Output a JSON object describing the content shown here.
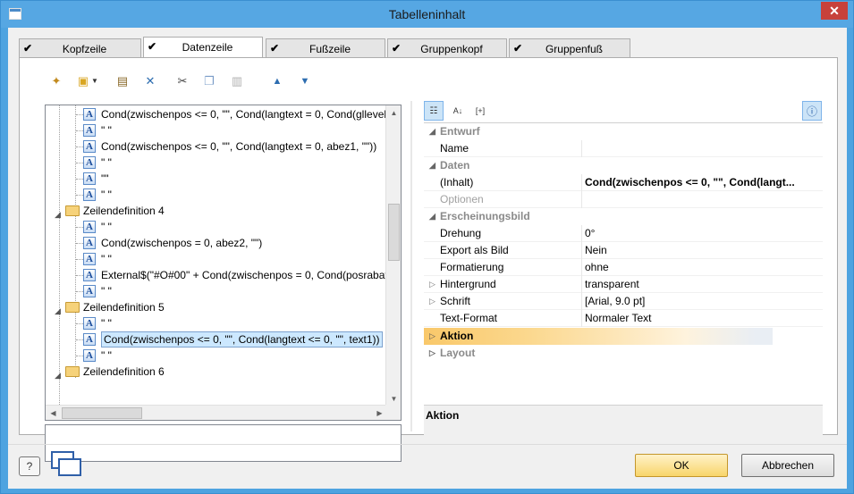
{
  "window": {
    "title": "Tabelleninhalt",
    "close_glyph": "✕"
  },
  "tabs": [
    {
      "label": "Kopfzeile",
      "checked": true
    },
    {
      "label": "Datenzeile",
      "checked": true,
      "active": true
    },
    {
      "label": "Fußzeile",
      "checked": true
    },
    {
      "label": "Gruppenkopf",
      "checked": true
    },
    {
      "label": "Gruppenfuß",
      "checked": true
    }
  ],
  "check_glyph": "✔",
  "toolbar": {
    "icons": [
      "wand-icon",
      "new-item-icon",
      "dropdown-arrow-icon",
      "properties-icon",
      "delete-icon",
      "cut-icon",
      "copy-icon",
      "paste-icon",
      "move-up-icon",
      "move-down-icon"
    ]
  },
  "tree": {
    "rows": [
      {
        "type": "field",
        "text": "Cond(zwischenpos <= 0, \"\", Cond(langtext = 0, Cond(gllevel"
      },
      {
        "type": "field",
        "text": "\" \""
      },
      {
        "type": "field",
        "text": "Cond(zwischenpos <= 0, \"\", Cond(langtext = 0, abez1, \"\"))"
      },
      {
        "type": "field",
        "text": "\" \""
      },
      {
        "type": "field",
        "text": "\"\""
      },
      {
        "type": "field",
        "text": "\" \""
      },
      {
        "type": "group",
        "text": "Zeilendefinition  4"
      },
      {
        "type": "field",
        "text": "\" \""
      },
      {
        "type": "field",
        "text": "Cond(zwischenpos = 0, abez2, \"\")"
      },
      {
        "type": "field",
        "text": "\" \""
      },
      {
        "type": "field",
        "text": "External$(\"#O#00\" + Cond(zwischenpos = 0, Cond(posrabatt"
      },
      {
        "type": "field",
        "text": "\" \""
      },
      {
        "type": "group",
        "text": "Zeilendefinition  5"
      },
      {
        "type": "field",
        "text": "\" \""
      },
      {
        "type": "field",
        "text": "Cond(zwischenpos <= 0, \"\", Cond(langtext <= 0, \"\", text1))",
        "selected": true
      },
      {
        "type": "field",
        "text": "\" \""
      },
      {
        "type": "group",
        "text": "Zeilendefinition  6"
      }
    ]
  },
  "properties": {
    "categories": {
      "entwurf": "Entwurf",
      "daten": "Daten",
      "erscheinungsbild": "Erscheinungsbild",
      "layout": "Layout"
    },
    "name": {
      "label": "Name",
      "value": ""
    },
    "inhalt": {
      "label": "(Inhalt)",
      "value": "Cond(zwischenpos <= 0, \"\", Cond(langt..."
    },
    "optionen": {
      "label": "Optionen",
      "value": ""
    },
    "drehung": {
      "label": "Drehung",
      "value": "0°"
    },
    "export": {
      "label": "Export als Bild",
      "value": "Nein"
    },
    "formatierung": {
      "label": "Formatierung",
      "value": "ohne"
    },
    "hintergrund": {
      "label": "Hintergrund",
      "value": "transparent"
    },
    "schrift": {
      "label": "Schrift",
      "value": "[Arial, 9.0 pt]"
    },
    "textformat": {
      "label": "Text-Format",
      "value": "Normaler Text"
    },
    "aktion": {
      "label": "Aktion"
    }
  },
  "description": {
    "title": "Aktion"
  },
  "buttons": {
    "ok": "OK",
    "cancel": "Abbrechen",
    "help": "?"
  }
}
